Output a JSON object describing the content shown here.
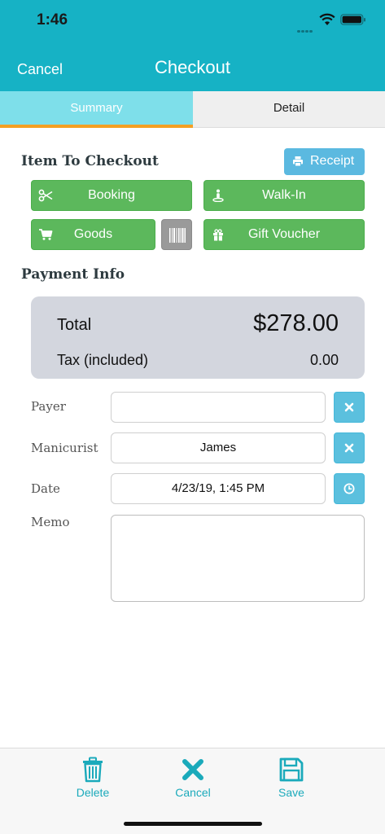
{
  "status_bar": {
    "time": "1:46"
  },
  "nav": {
    "cancel_label": "Cancel",
    "title": "Checkout"
  },
  "tabs": [
    {
      "label": "Summary",
      "active": true
    },
    {
      "label": "Detail",
      "active": false
    }
  ],
  "items_section": {
    "title": "Item To Checkout",
    "receipt_label": "Receipt",
    "buttons": {
      "booking": {
        "label": "Booking",
        "icon": "scissors-icon"
      },
      "walk_in": {
        "label": "Walk-In",
        "icon": "walk-in-person-icon"
      },
      "goods": {
        "label": "Goods",
        "icon": "cart-icon"
      },
      "barcode": {
        "icon": "barcode-icon"
      },
      "gift_voucher": {
        "label": "Gift Voucher",
        "icon": "gift-icon"
      }
    }
  },
  "payment_section": {
    "title": "Payment Info",
    "total_label": "Total",
    "total_value": "$278.00",
    "tax_label": "Tax (included)",
    "tax_value": "0.00"
  },
  "form": {
    "payer": {
      "label": "Payer",
      "value": ""
    },
    "manicurist": {
      "label": "Manicurist",
      "value": "James"
    },
    "date": {
      "label": "Date",
      "value": "4/23/19, 1:45 PM"
    },
    "memo": {
      "label": "Memo",
      "value": ""
    }
  },
  "toolbar": {
    "delete_label": "Delete",
    "cancel_label": "Cancel",
    "save_label": "Save"
  },
  "colors": {
    "header": "#16b2c5",
    "active_tab": "#7edfea",
    "tab_underline": "#f4a023",
    "green_button": "#5cb85c",
    "info_button": "#5bc0de",
    "totals_card": "#d3d6de",
    "toolbar_icon": "#1baabb"
  }
}
